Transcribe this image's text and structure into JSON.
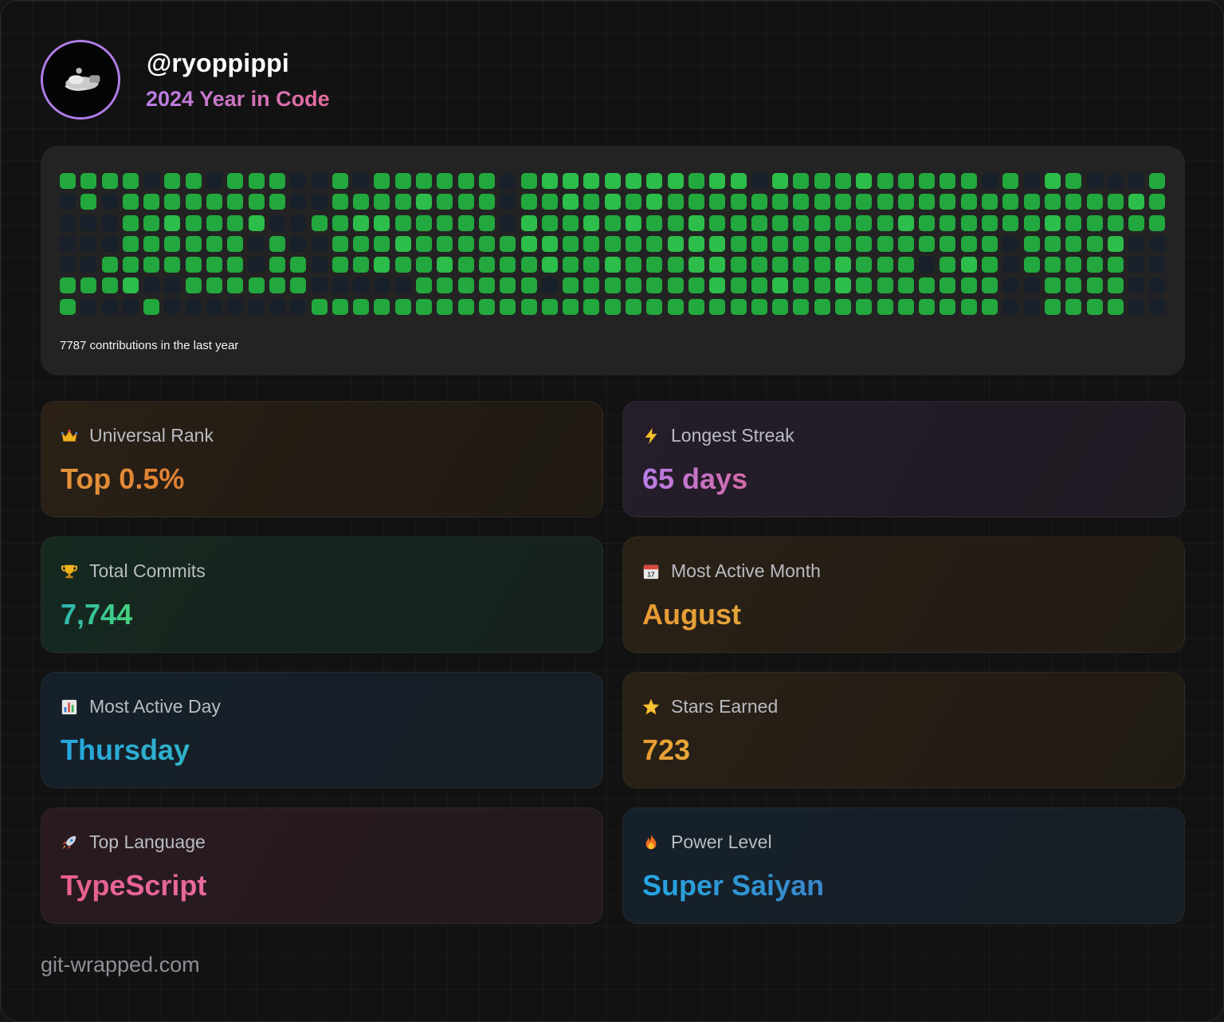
{
  "profile": {
    "username": "@ryoppippi",
    "subtitle": "2024 Year in Code"
  },
  "contributions": {
    "caption": "7787 contributions in the last year",
    "weeks": 53,
    "days_per_week": 7,
    "levels": [
      [
        1,
        0,
        0,
        0,
        0,
        1,
        1
      ],
      [
        1,
        1,
        0,
        0,
        0,
        1,
        0
      ],
      [
        1,
        0,
        0,
        0,
        1,
        1,
        0
      ],
      [
        1,
        1,
        1,
        1,
        1,
        2,
        0
      ],
      [
        0,
        1,
        1,
        1,
        1,
        0,
        1
      ],
      [
        1,
        1,
        2,
        1,
        1,
        0,
        0
      ],
      [
        1,
        1,
        1,
        1,
        1,
        1,
        0
      ],
      [
        0,
        1,
        1,
        1,
        1,
        1,
        0
      ],
      [
        1,
        1,
        1,
        1,
        1,
        1,
        0
      ],
      [
        1,
        1,
        2,
        0,
        0,
        1,
        0
      ],
      [
        1,
        1,
        0,
        1,
        1,
        1,
        0
      ],
      [
        0,
        0,
        0,
        0,
        1,
        1,
        0
      ],
      [
        0,
        0,
        1,
        0,
        0,
        0,
        1
      ],
      [
        1,
        1,
        1,
        1,
        1,
        0,
        1
      ],
      [
        0,
        1,
        2,
        1,
        1,
        0,
        1
      ],
      [
        1,
        1,
        2,
        1,
        2,
        0,
        1
      ],
      [
        1,
        1,
        1,
        2,
        1,
        0,
        1
      ],
      [
        1,
        2,
        1,
        1,
        1,
        1,
        1
      ],
      [
        1,
        1,
        1,
        1,
        2,
        1,
        1
      ],
      [
        1,
        1,
        1,
        1,
        1,
        1,
        1
      ],
      [
        1,
        1,
        1,
        1,
        1,
        1,
        1
      ],
      [
        0,
        0,
        0,
        1,
        1,
        1,
        1
      ],
      [
        1,
        1,
        2,
        2,
        1,
        1,
        1
      ],
      [
        2,
        1,
        1,
        2,
        2,
        0,
        1
      ],
      [
        2,
        2,
        1,
        1,
        1,
        1,
        1
      ],
      [
        2,
        1,
        2,
        1,
        1,
        1,
        1
      ],
      [
        2,
        2,
        1,
        1,
        2,
        1,
        1
      ],
      [
        2,
        1,
        2,
        1,
        1,
        1,
        1
      ],
      [
        2,
        2,
        1,
        1,
        1,
        1,
        1
      ],
      [
        2,
        1,
        1,
        2,
        1,
        1,
        1
      ],
      [
        1,
        1,
        2,
        2,
        2,
        1,
        1
      ],
      [
        2,
        1,
        1,
        2,
        2,
        2,
        1
      ],
      [
        2,
        1,
        1,
        1,
        1,
        1,
        1
      ],
      [
        0,
        1,
        1,
        1,
        1,
        1,
        1
      ],
      [
        2,
        1,
        1,
        1,
        1,
        2,
        1
      ],
      [
        1,
        1,
        1,
        1,
        1,
        1,
        1
      ],
      [
        1,
        1,
        1,
        1,
        1,
        1,
        1
      ],
      [
        1,
        1,
        1,
        1,
        2,
        2,
        1
      ],
      [
        2,
        1,
        1,
        1,
        1,
        1,
        1
      ],
      [
        1,
        1,
        1,
        1,
        1,
        1,
        1
      ],
      [
        1,
        1,
        2,
        1,
        1,
        1,
        1
      ],
      [
        1,
        1,
        1,
        1,
        0,
        1,
        1
      ],
      [
        1,
        1,
        1,
        1,
        1,
        1,
        1
      ],
      [
        1,
        1,
        1,
        1,
        2,
        1,
        1
      ],
      [
        0,
        1,
        1,
        1,
        1,
        1,
        1
      ],
      [
        1,
        1,
        1,
        0,
        0,
        0,
        0
      ],
      [
        0,
        1,
        1,
        1,
        1,
        0,
        0
      ],
      [
        2,
        1,
        2,
        1,
        1,
        1,
        1
      ],
      [
        1,
        1,
        1,
        1,
        1,
        1,
        1
      ],
      [
        0,
        1,
        1,
        1,
        1,
        1,
        1
      ],
      [
        0,
        1,
        1,
        2,
        1,
        1,
        1
      ],
      [
        0,
        2,
        1,
        0,
        0,
        0,
        0
      ],
      [
        1,
        1,
        1,
        0,
        0,
        0,
        0
      ]
    ]
  },
  "stats": [
    {
      "label": "Universal Rank",
      "value": "Top 0.5%",
      "icon": "crown-icon"
    },
    {
      "label": "Longest Streak",
      "value": "65 days",
      "icon": "lightning-icon"
    },
    {
      "label": "Total Commits",
      "value": "7,744",
      "icon": "trophy-icon"
    },
    {
      "label": "Most Active Month",
      "value": "August",
      "icon": "calendar-icon"
    },
    {
      "label": "Most Active Day",
      "value": "Thursday",
      "icon": "bar-chart-icon"
    },
    {
      "label": "Stars Earned",
      "value": "723",
      "icon": "star-icon"
    },
    {
      "label": "Top Language",
      "value": "TypeScript",
      "icon": "rocket-icon"
    },
    {
      "label": "Power Level",
      "value": "Super Saiyan",
      "icon": "fire-icon"
    }
  ],
  "colors": {
    "cell_empty": "#18202b",
    "cell_green_1": "#22a83e",
    "cell_green_2": "#2cbd4a",
    "cell_green_3": "#34cf58",
    "cell_green_4": "#3ddd64",
    "accent_purple": "#b77ee6",
    "accent_pink": "#e66a9b",
    "accent_orange": "#e3933a",
    "accent_teal": "#35c3a4",
    "accent_blue": "#2aa3dc"
  },
  "footer": {
    "brand": "git-wrapped.com"
  }
}
